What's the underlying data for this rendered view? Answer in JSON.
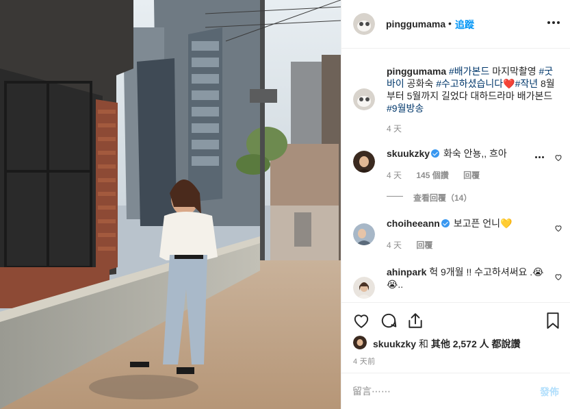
{
  "post": {
    "username": "pinggumama",
    "follow_label": "追蹤",
    "dot": "•"
  },
  "caption": {
    "username": "pinggumama",
    "tag1": "#배가본드",
    "text1": " 마지막촬영 ",
    "tag2": "#굿바이",
    "text2": " 공화숙 ",
    "tag3": "#수고하셨습니다",
    "emoji": "❤️",
    "tag4": "#작년",
    "text3": " 8월부터 5월까지 길었다 대하드라마 배가본드 ",
    "tag5": "#9월방송",
    "time": "4 天"
  },
  "comments": [
    {
      "username": "skuukzky",
      "verified": true,
      "text": "화숙 안뇽,, 흐아",
      "time": "4 天",
      "likes": "145 個讚",
      "reply_label": "回覆",
      "view_replies": "查看回覆（14）"
    },
    {
      "username": "choiheeann",
      "verified": true,
      "text": "보고픈 언니💛",
      "time": "4 天",
      "reply_label": "回覆"
    },
    {
      "username": "ahinpark",
      "verified": false,
      "text": "헉 9개월 !! 수고하셔써요 .😭😭.."
    }
  ],
  "likes": {
    "username": "skuukzky",
    "and_label": "和",
    "others_label": "其他",
    "count": "2,572",
    "suffix": "人 都說讚"
  },
  "timestamp": "4 天前",
  "composer": {
    "placeholder": "留言⋯⋯",
    "post_label": "發佈"
  },
  "icons": {
    "like": "heart-icon",
    "comment": "comment-icon",
    "share": "share-icon",
    "save": "bookmark-icon",
    "more": "more-options-icon",
    "verified": "verified-badge-icon"
  },
  "colors": {
    "link": "#0095f6",
    "hashtag": "#00376b",
    "muted": "#8e8e8e",
    "verified": "#3897f0",
    "post_disabled": "#b2dffc"
  }
}
